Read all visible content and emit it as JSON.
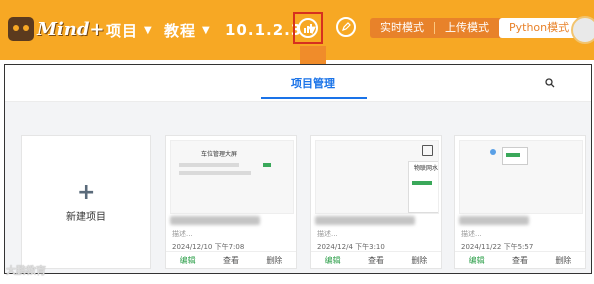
{
  "toolbar": {
    "logo_text": "Mind+",
    "menu_project": "项目",
    "menu_tutorial": "教程",
    "version": "10.1.2.3",
    "modes": {
      "realtime": "实时模式",
      "upload": "上传模式",
      "python": "Python模式"
    },
    "brand_color": "#f7a824",
    "highlight_color": "#d6301f"
  },
  "panel": {
    "tab_title": "项目管理",
    "new_project_label": "新建项目",
    "projects": [
      {
        "thumb_title": "车位管理大屏",
        "description": "描述...",
        "date": "2024/12/10  下午7:08",
        "actions": [
          "编辑",
          "查看",
          "删除"
        ]
      },
      {
        "thumb_title": "物联网水",
        "description": "描述...",
        "date": "2024/12/4  下午3:10",
        "actions": [
          "编辑",
          "查看",
          "删除"
        ]
      },
      {
        "thumb_title": "",
        "description": "描述...",
        "date": "2024/11/22  下午5:57",
        "actions": [
          "编辑",
          "查看",
          "删除"
        ]
      }
    ],
    "accent_color": "#1a73e8",
    "edit_color": "#2d9f4a"
  },
  "watermark": "大鹏教育"
}
